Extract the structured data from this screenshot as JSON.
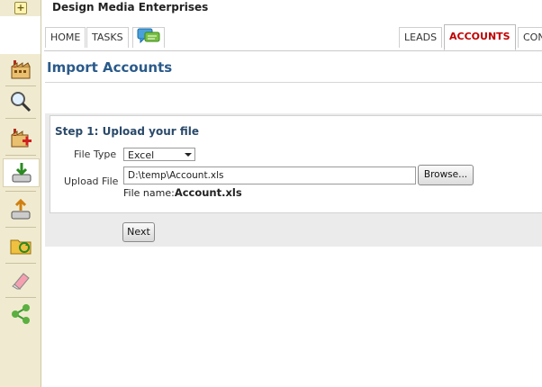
{
  "app": {
    "title": "Design Media Enterprises"
  },
  "nav": {
    "left_tabs": [
      "HOME",
      "TASKS"
    ],
    "right_tabs": [
      "LEADS",
      "ACCOUNTS",
      "CON"
    ],
    "active_tab": "ACCOUNTS"
  },
  "page": {
    "title": "Import Accounts"
  },
  "step": {
    "title": "Step 1: Upload your file",
    "file_type_label": "File Type",
    "file_type_value": "Excel",
    "upload_label": "Upload File",
    "upload_value": "D:\\temp\\Account.xls",
    "browse_label": "Browse...",
    "file_name_prefix": "File name:",
    "file_name_value": "Account.xls"
  },
  "actions": {
    "next_label": "Next"
  },
  "rail": {
    "icons": [
      "expand-icon",
      "factory-icon",
      "search-icon",
      "factory-add-icon",
      "import-icon",
      "export-icon",
      "folder-sync-icon",
      "eraser-icon",
      "share-icon"
    ]
  },
  "colors": {
    "accent_title": "#2a5a8a",
    "active_tab": "#c00000",
    "rail_bg": "#f0ebd0"
  }
}
